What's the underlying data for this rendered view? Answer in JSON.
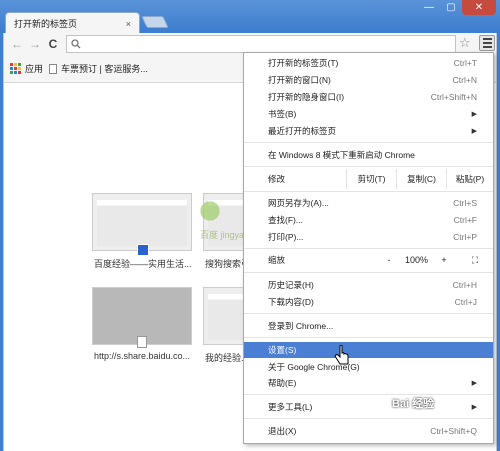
{
  "window": {
    "minimize": "—",
    "maximize": "▢",
    "close": "✕"
  },
  "tab": {
    "title": "打开新的标签页",
    "close": "×"
  },
  "toolbar": {
    "back": "←",
    "forward": "→",
    "reload": "C",
    "omnibox_value": "",
    "star": "☆"
  },
  "bookmarks": {
    "apps_label": "应用",
    "item1": "车票预订 | 客运服务..."
  },
  "thumbnails": [
    {
      "caption": "百度经验——实用生活..."
    },
    {
      "caption": "搜狗搜索引"
    },
    {
      "caption": "http://s.share.baidu.co..."
    },
    {
      "caption": "我的经验..."
    }
  ],
  "watermark": "百度 jingyan.baidu.com",
  "menu": {
    "new_tab": {
      "label": "打开新的标签页(T)",
      "shortcut": "Ctrl+T"
    },
    "new_window": {
      "label": "打开新的窗口(N)",
      "shortcut": "Ctrl+N"
    },
    "incognito": {
      "label": "打开新的隐身窗口(I)",
      "shortcut": "Ctrl+Shift+N"
    },
    "bookmarks": {
      "label": "书签(B)"
    },
    "recent_tabs": {
      "label": "最近打开的标签页"
    },
    "relaunch": {
      "label": "在 Windows 8 模式下重新启动 Chrome"
    },
    "edit": {
      "label": "修改",
      "cut": "剪切(T)",
      "copy": "复制(C)",
      "paste": "粘贴(P)"
    },
    "save_as": {
      "label": "网页另存为(A)...",
      "shortcut": "Ctrl+S"
    },
    "find": {
      "label": "查找(F)...",
      "shortcut": "Ctrl+F"
    },
    "print": {
      "label": "打印(P)...",
      "shortcut": "Ctrl+P"
    },
    "zoom": {
      "label": "缩放",
      "minus": "-",
      "value": "100%",
      "plus": "+",
      "fullscreen": "⛶"
    },
    "history": {
      "label": "历史记录(H)",
      "shortcut": "Ctrl+H"
    },
    "downloads": {
      "label": "下载内容(D)",
      "shortcut": "Ctrl+J"
    },
    "signin": {
      "label": "登录到 Chrome..."
    },
    "settings": {
      "label": "设置(S)"
    },
    "about": {
      "label": "关于 Google Chrome(G)"
    },
    "help": {
      "label": "帮助(E)"
    },
    "more_tools": {
      "label": "更多工具(L)"
    },
    "exit": {
      "label": "退出(X)",
      "shortcut": "Ctrl+Shift+Q"
    }
  },
  "brand_watermark": "Bai 经验",
  "colors": {
    "highlight": "#4a7fd4",
    "frame": "#3f7fcf",
    "close_button": "#c74a3f"
  }
}
